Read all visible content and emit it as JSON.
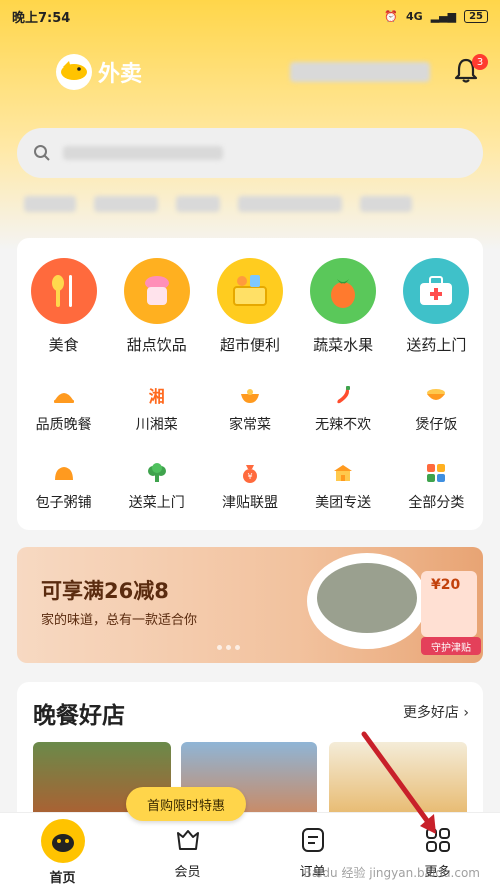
{
  "status_bar": {
    "time": "晚上7:54",
    "signal": "4G",
    "battery": "25"
  },
  "header": {
    "title": "外卖",
    "notification_count": "3"
  },
  "categories_primary": [
    {
      "label": "美食",
      "icon": "food-icon",
      "color": "#ff6a3d"
    },
    {
      "label": "甜点饮品",
      "icon": "dessert-icon",
      "color": "#ffb020"
    },
    {
      "label": "超市便利",
      "icon": "supermarket-icon",
      "color": "#ffcc1f"
    },
    {
      "label": "蔬菜水果",
      "icon": "vegetable-icon",
      "color": "#5ac85a"
    },
    {
      "label": "送药上门",
      "icon": "medicine-icon",
      "color": "#3fc1c9"
    }
  ],
  "categories_secondary": [
    {
      "label": "品质晚餐",
      "icon": "dinner-icon"
    },
    {
      "label": "川湘菜",
      "icon": "sichuan-icon"
    },
    {
      "label": "家常菜",
      "icon": "home-dish-icon"
    },
    {
      "label": "无辣不欢",
      "icon": "chili-icon"
    },
    {
      "label": "煲仔饭",
      "icon": "claypot-icon"
    },
    {
      "label": "包子粥铺",
      "icon": "bun-icon"
    },
    {
      "label": "送菜上门",
      "icon": "greens-icon"
    },
    {
      "label": "津贴联盟",
      "icon": "coupon-bag-icon"
    },
    {
      "label": "美团专送",
      "icon": "delivery-icon"
    },
    {
      "label": "全部分类",
      "icon": "all-categories-icon"
    }
  ],
  "banner": {
    "title": "可享满26减8",
    "subtitle": "家的味道，总有一款适合你",
    "coupon_amount": "¥20",
    "coupon_label": "守护津贴"
  },
  "section": {
    "title": "晚餐好店",
    "more": "更多好店 ›"
  },
  "toast": "首购限时特惠",
  "bottom_nav": [
    {
      "label": "首页",
      "icon": "home-icon"
    },
    {
      "label": "会员",
      "icon": "member-icon"
    },
    {
      "label": "订单",
      "icon": "order-icon"
    },
    {
      "label": "更多",
      "icon": "more-icon"
    }
  ],
  "watermark": "Baidu 经验 jingyan.baidu.com"
}
